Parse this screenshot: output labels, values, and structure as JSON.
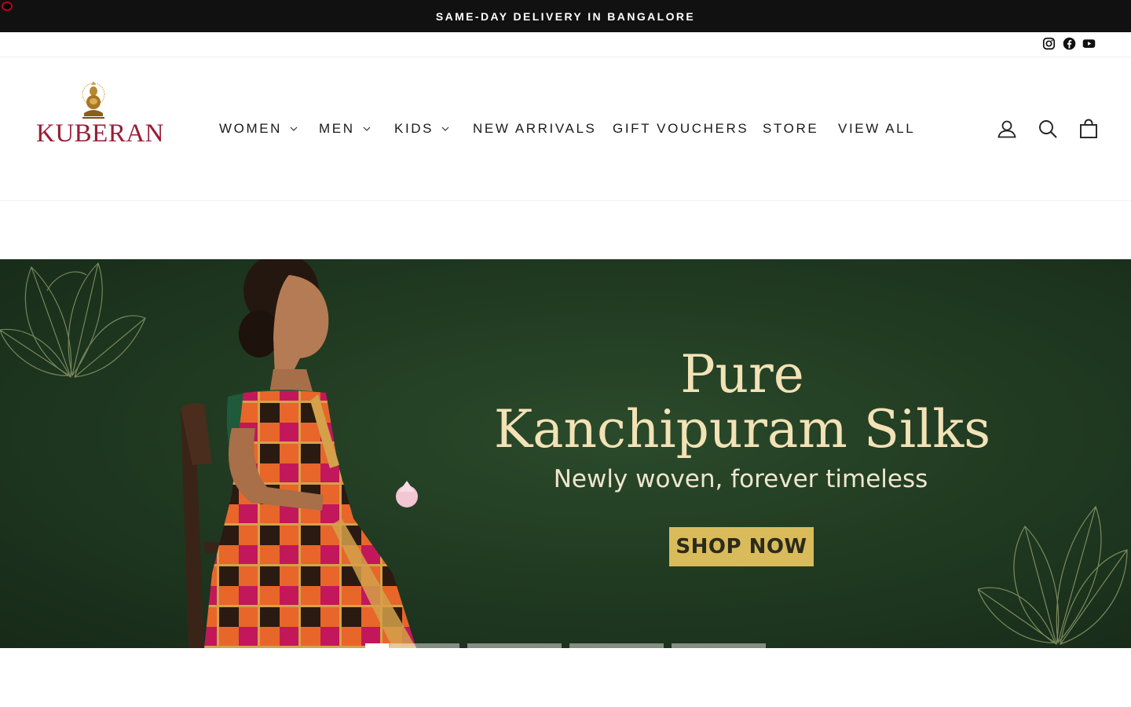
{
  "announcement": {
    "text": "SAME-DAY DELIVERY IN BANGALORE"
  },
  "social": [
    {
      "name": "instagram-icon",
      "label": "Instagram"
    },
    {
      "name": "facebook-icon",
      "label": "Facebook"
    },
    {
      "name": "youtube-icon",
      "label": "YouTube"
    }
  ],
  "brand": {
    "name": "KUBERAN",
    "color": "#9a1c36"
  },
  "nav": {
    "items": [
      {
        "label": "WOMEN",
        "has_dropdown": true
      },
      {
        "label": "MEN",
        "has_dropdown": true
      },
      {
        "label": "KIDS",
        "has_dropdown": true
      },
      {
        "label": "NEW ARRIVALS",
        "has_dropdown": false
      },
      {
        "label": "GIFT VOUCHERS",
        "has_dropdown": false
      },
      {
        "label": "STORE",
        "has_dropdown": false
      },
      {
        "label": "VIEW ALL",
        "has_dropdown": false
      }
    ]
  },
  "header_icons": [
    {
      "name": "account-icon",
      "label": "Log in"
    },
    {
      "name": "search-icon",
      "label": "Search"
    },
    {
      "name": "cart-icon",
      "label": "Cart"
    }
  ],
  "hero": {
    "headline_line1": "Pure",
    "headline_line2": "Kanchipuram Silks",
    "subline": "Newly woven, forever timeless",
    "cta": "SHOP NOW",
    "colors": {
      "background": "#213b22",
      "headline": "#f2e2b6",
      "cta_bg": "#d9bb5c"
    }
  },
  "slider": {
    "slide_count": 4,
    "active_index": 0,
    "active_progress": 0.25
  }
}
